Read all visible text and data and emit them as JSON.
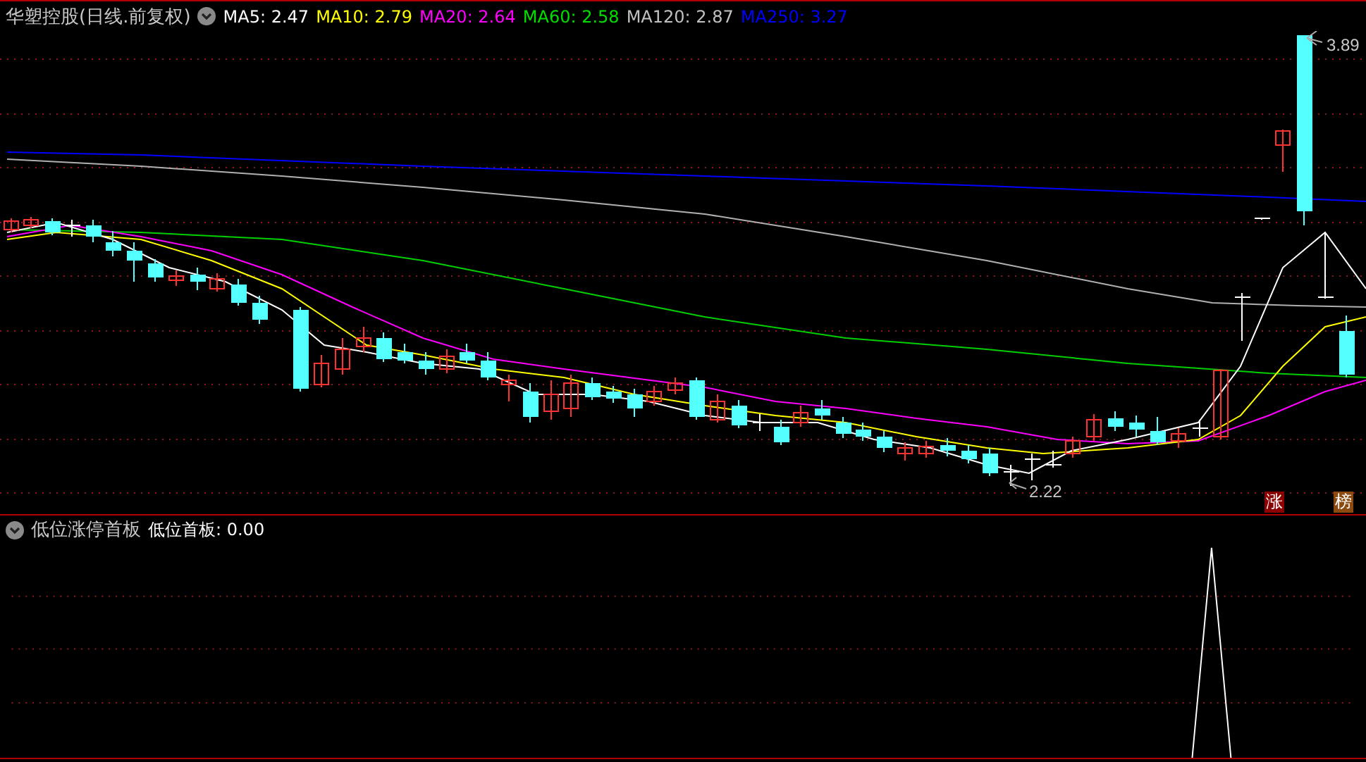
{
  "main_panel": {
    "title": "华塑控股(日线.前复权)",
    "indicators": [
      {
        "label": "MA5: 2.47",
        "color": "#ffffff"
      },
      {
        "label": "MA10: 2.79",
        "color": "#ffff00"
      },
      {
        "label": "MA20: 2.64",
        "color": "#ff00ff"
      },
      {
        "label": "MA60: 2.58",
        "color": "#00e000"
      },
      {
        "label": "MA120: 2.87",
        "color": "#c0c0c0"
      },
      {
        "label": "MA250: 3.27",
        "color": "#0000ff"
      }
    ],
    "high_label": "3.89",
    "low_label": "2.22",
    "tags": [
      {
        "text": "涨",
        "color": "#8b0000"
      },
      {
        "text": "榜",
        "color": "#8b4a10"
      }
    ]
  },
  "sub_panel": {
    "title": "低位涨停首板",
    "indicator": "低位首板: 0.00"
  }
}
